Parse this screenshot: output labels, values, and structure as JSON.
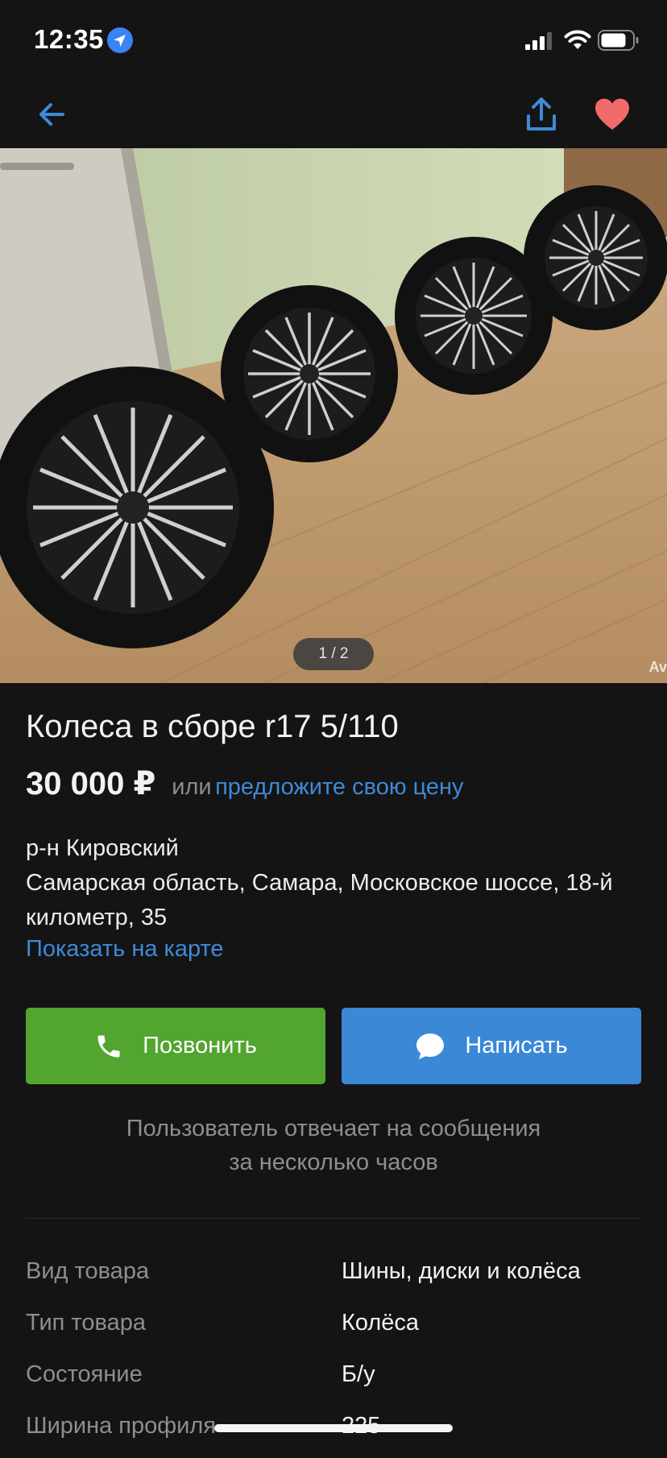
{
  "status_bar": {
    "time": "12:35"
  },
  "nav": {
    "back": "back-arrow-icon",
    "share": "share-icon",
    "favorite": "heart-icon"
  },
  "gallery": {
    "counter": "1 / 2",
    "watermark": "Av"
  },
  "listing": {
    "title": "Колеса в сборе r17 5/110",
    "price": "30 000 ₽",
    "or_text": "или",
    "offer_link": "предложите свою цену",
    "district": "р-н Кировский",
    "address": "Самарская область, Самара, Московское шоссе, 18-й километр, 35",
    "show_on_map": "Показать на карте"
  },
  "actions": {
    "call_label": "Позвонить",
    "write_label": "Написать"
  },
  "reply_note": {
    "line1": "Пользователь отвечает на сообщения",
    "line2": "за несколько часов"
  },
  "properties": [
    {
      "label": "Вид товара",
      "value": "Шины, диски и колёса"
    },
    {
      "label": "Тип товара",
      "value": "Колёса"
    },
    {
      "label": "Состояние",
      "value": "Б/у"
    },
    {
      "label": "Ширина профиля",
      "value": "225"
    }
  ],
  "colors": {
    "background": "#141414",
    "link": "#3e8ad8",
    "call_button": "#52a52e",
    "write_button": "#3a88d6",
    "favorite": "#f26a6a"
  }
}
